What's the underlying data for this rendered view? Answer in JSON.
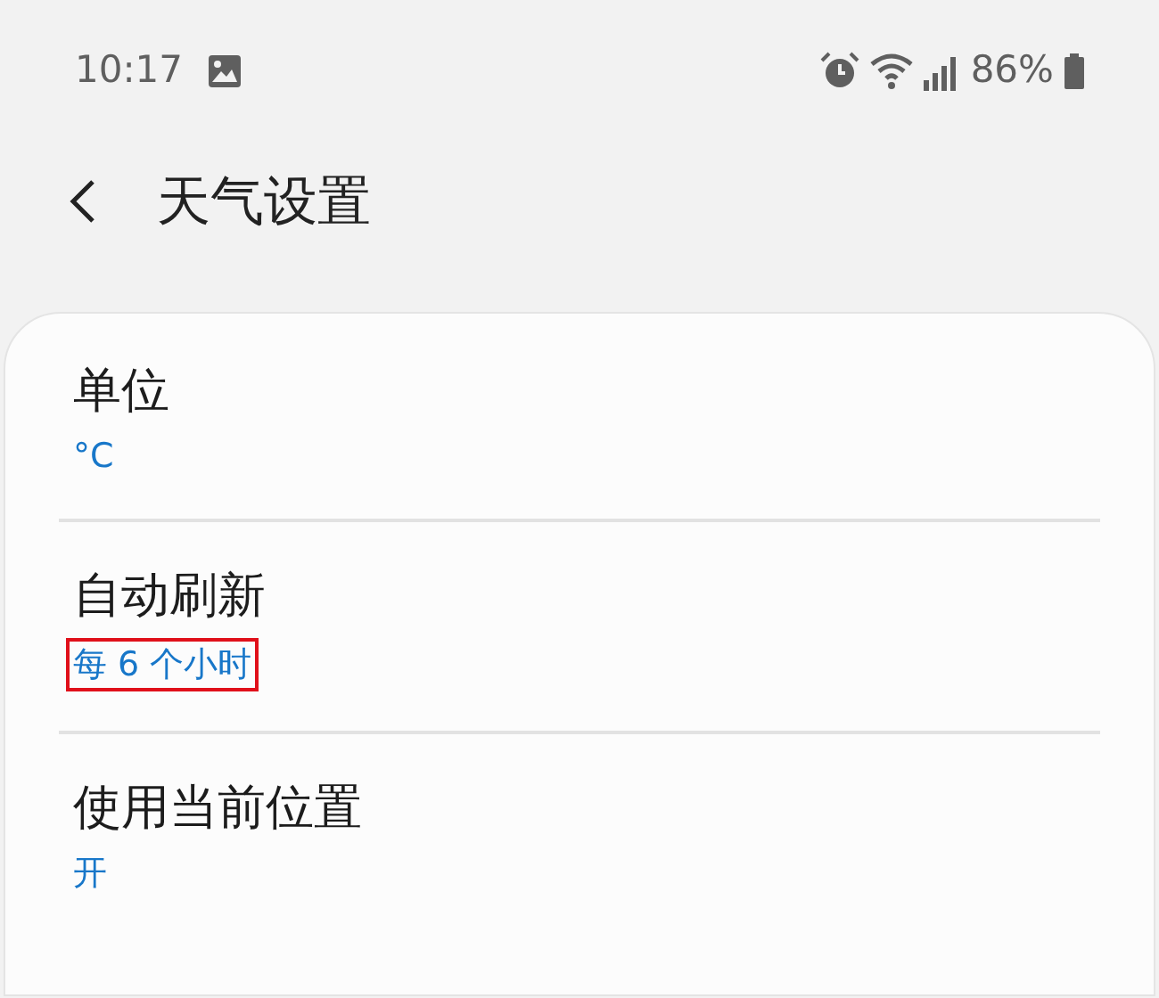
{
  "status_bar": {
    "time": "10:17",
    "battery": "86%"
  },
  "header": {
    "title": "天气设置"
  },
  "settings": [
    {
      "title": "单位",
      "value": "°C",
      "highlighted": false
    },
    {
      "title": "自动刷新",
      "value": "每 6 个小时",
      "highlighted": true
    },
    {
      "title": "使用当前位置",
      "value": "开",
      "highlighted": false
    }
  ]
}
